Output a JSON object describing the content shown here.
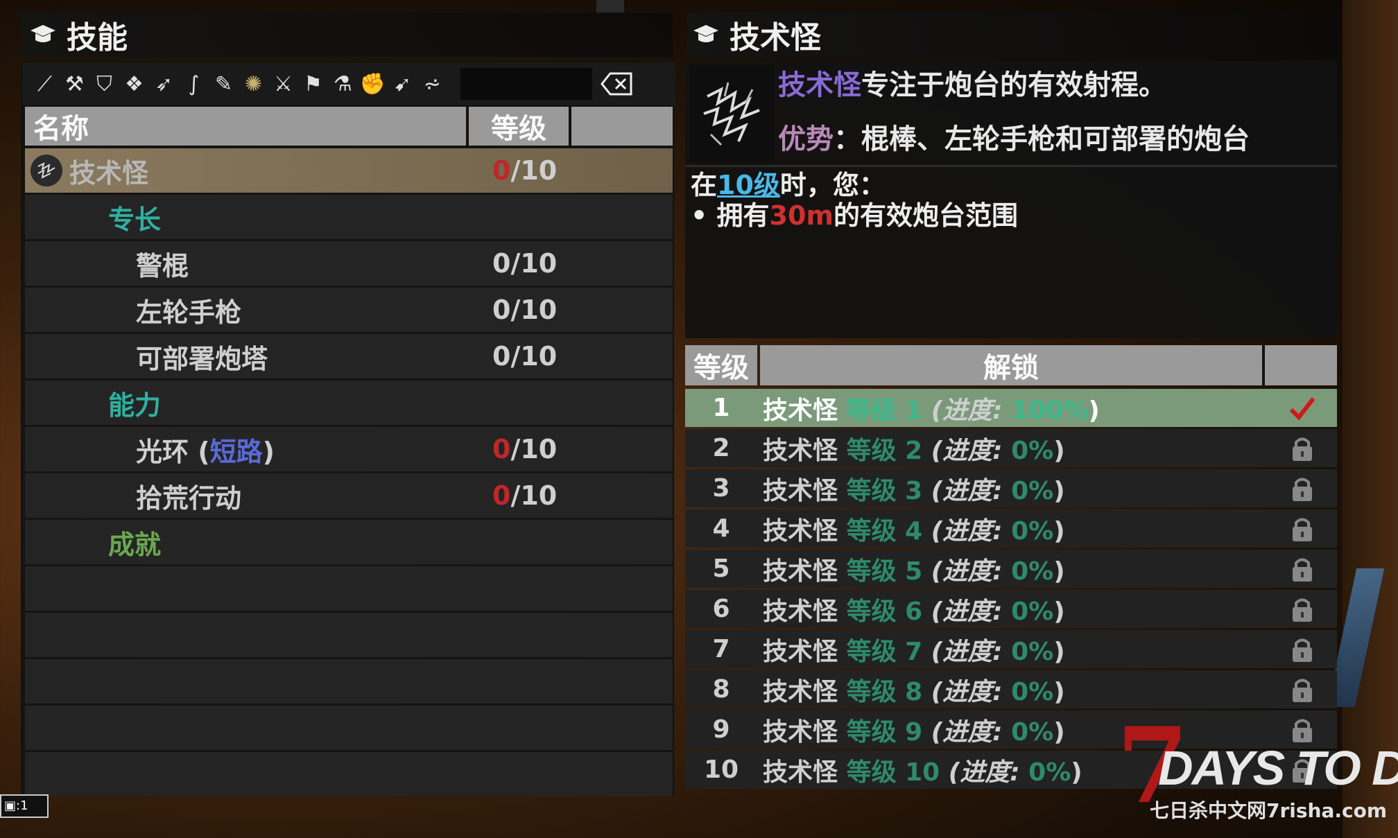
{
  "left": {
    "title": "技能",
    "filter_icons": [
      "all-skills-icon",
      "hammer-icon",
      "shield-icon",
      "armor-icon",
      "bow-icon",
      "spear-icon",
      "knife-icon",
      "tech-fiend-icon",
      "melee-icon",
      "club-icon",
      "shotgun-icon",
      "fist-icon",
      "rifle-icon",
      "explosives-icon"
    ],
    "columns": {
      "name": "名称",
      "level": "等级"
    },
    "rows": [
      {
        "type": "selected",
        "label": "技术怪",
        "cur": "0",
        "max": "/10",
        "cur_red": true
      },
      {
        "type": "category",
        "label": "专长"
      },
      {
        "type": "item",
        "label": "警棍",
        "cur": "0",
        "max": "/10"
      },
      {
        "type": "item",
        "label": "左轮手枪",
        "cur": "0",
        "max": "/10"
      },
      {
        "type": "item",
        "label": "可部署炮塔",
        "cur": "0",
        "max": "/10"
      },
      {
        "type": "category",
        "label": "能力"
      },
      {
        "type": "item",
        "label": "光环 (",
        "label_blue": "短路",
        "label_end": ")",
        "cur": "0",
        "max": "/10",
        "cur_red": true
      },
      {
        "type": "item",
        "label": "拾荒行动",
        "cur": "0",
        "max": "/10",
        "cur_red": true
      },
      {
        "type": "category_green",
        "label": "成就"
      },
      {
        "type": "empty"
      },
      {
        "type": "empty"
      },
      {
        "type": "empty"
      },
      {
        "type": "empty"
      },
      {
        "type": "empty"
      }
    ]
  },
  "right": {
    "title": "技术怪",
    "desc_name": "技术怪",
    "desc_text": "专注于炮台的有效射程。",
    "strength_label": "优势",
    "strength_text": "：棍棒、左轮手枪和可部署的炮台",
    "at_prefix": "在",
    "at_level": "10级",
    "at_suffix": "时，您：",
    "bullet_prefix": "• 拥有",
    "bullet_value": "30m",
    "bullet_suffix": "的有效炮台范围",
    "unlock_columns": {
      "level": "等级",
      "unlock": "解锁"
    },
    "unlocks": [
      {
        "num": "1",
        "name": "技术怪",
        "lvl": "等级 1",
        "prog": "(进度:",
        "pct": "100%",
        "end": ")",
        "done": true
      },
      {
        "num": "2",
        "name": "技术怪",
        "lvl": "等级 2",
        "prog": "(进度:",
        "pct": "0%",
        "end": ")",
        "done": false
      },
      {
        "num": "3",
        "name": "技术怪",
        "lvl": "等级 3",
        "prog": "(进度:",
        "pct": "0%",
        "end": ")",
        "done": false
      },
      {
        "num": "4",
        "name": "技术怪",
        "lvl": "等级 4",
        "prog": "(进度:",
        "pct": "0%",
        "end": ")",
        "done": false
      },
      {
        "num": "5",
        "name": "技术怪",
        "lvl": "等级 5",
        "prog": "(进度:",
        "pct": "0%",
        "end": ")",
        "done": false
      },
      {
        "num": "6",
        "name": "技术怪",
        "lvl": "等级 6",
        "prog": "(进度:",
        "pct": "0%",
        "end": ")",
        "done": false
      },
      {
        "num": "7",
        "name": "技术怪",
        "lvl": "等级 7",
        "prog": "(进度:",
        "pct": "0%",
        "end": ")",
        "done": false
      },
      {
        "num": "8",
        "name": "技术怪",
        "lvl": "等级 8",
        "prog": "(进度:",
        "pct": "0%",
        "end": ")",
        "done": false
      },
      {
        "num": "9",
        "name": "技术怪",
        "lvl": "等级 9",
        "prog": "(进度:",
        "pct": "0%",
        "end": ")",
        "done": false
      },
      {
        "num": "10",
        "name": "技术怪",
        "lvl": "等级 10",
        "prog": "(进度:",
        "pct": "0%",
        "end": ")",
        "done": false
      }
    ]
  },
  "logo": {
    "seven": "7",
    "main": "DAYS TO DIE",
    "sub": "七日杀中文网7risha.com"
  },
  "corner": {
    "text": "1"
  }
}
